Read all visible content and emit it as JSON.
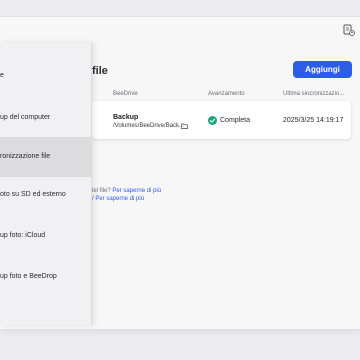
{
  "header": {
    "page_title": "file",
    "add_button_label": "Aggiungi"
  },
  "table": {
    "columns": [
      "BeeDrive",
      "Avanzamento",
      "Ultima sincronizzazio..."
    ],
    "rows": [
      {
        "name": "Backup",
        "path": "/Volumes/BeeDrive/Back...",
        "status": "Completa",
        "last_sync": "2025/3/25 14:19:17"
      }
    ]
  },
  "help": {
    "line1_prefix": "lel file? ",
    "line1_link": "Per saperne di più",
    "line2_link": "/ Per saperne di più"
  },
  "menu": {
    "items": [
      {
        "label": "e"
      },
      {
        "label": "up del computer"
      },
      {
        "label": "ronizzazione file"
      },
      {
        "label": "oto su SD ed esterno"
      },
      {
        "label": "up foto: iCloud"
      },
      {
        "label": "up foto e BeeDrop"
      }
    ],
    "selected_index": 2
  },
  "colors": {
    "accent": "#2d5de6",
    "success": "#1aa37a"
  },
  "icons": {
    "titlebar": "sync-status-icon",
    "row_status": "check-circle-icon",
    "row_path": "folder-open-icon"
  }
}
